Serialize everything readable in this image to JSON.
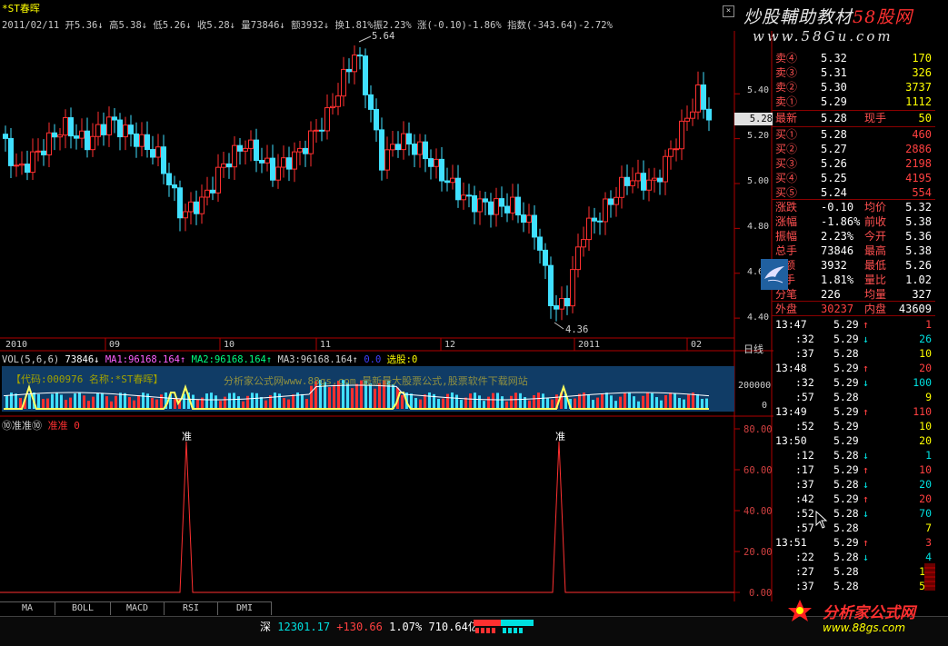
{
  "title_bar": {
    "stock_name": "*ST春晖",
    "close_icon": "close-icon"
  },
  "quote_line": {
    "date": "2011/02/11",
    "open": "开5.36↓",
    "high": "高5.38↓",
    "low": "低5.26↓",
    "close": "收5.28↓",
    "volume": "量73846↓",
    "amount": "额3932↓",
    "turnover": "换1.81%",
    "amplitude": "振2.23%",
    "change": "涨(-0.10)-1.86%",
    "index": "指数(-343.64)-2.72%"
  },
  "watermark": {
    "title_a": "炒股輔助教材",
    "title_b": "58股网",
    "url": "www.58Gu.com"
  },
  "main_chart": {
    "high_label": "5.64",
    "low_label": "4.36",
    "price_axis": [
      "5.40",
      "5.20",
      "5.00",
      "4.80",
      "4.60",
      "4.40"
    ],
    "current_price": "5.28",
    "date_axis": [
      "2010",
      "09",
      "10",
      "11",
      "12",
      "2011",
      "02"
    ],
    "period_label": "日线"
  },
  "volume_panel": {
    "header": {
      "vol": "VOL(5,6,6)",
      "vol_val": "73846↓",
      "ma1": "MA1:96168.164↑",
      "ma2": "MA2:96168.164↑",
      "ma3": "MA3:96168.164↑",
      "tail": "0.0",
      "pick": "选股:0"
    },
    "code_text": "【代码:000976 名称:*ST春晖】",
    "tooltip_text": "分析家公式网www.88gs.com 最新最大股票公式,股票软件下载网站",
    "axis": [
      "200000",
      "0"
    ]
  },
  "indicator_panel": {
    "name": "⑩准准⑩",
    "value": "准准 0",
    "axis": [
      "80.00",
      "60.00",
      "40.00",
      "20.00",
      "0.00"
    ],
    "marker": "准"
  },
  "chart_data": {
    "type": "line",
    "title": "*ST春晖",
    "indicator_spikes_x": [
      "2010-10",
      "2011-01"
    ],
    "indicator_peak": 80,
    "ylim": [
      4.36,
      5.64
    ]
  },
  "order_book": {
    "sell": [
      {
        "label": "卖④",
        "price": "5.32",
        "vol": "170"
      },
      {
        "label": "卖③",
        "price": "5.31",
        "vol": "326"
      },
      {
        "label": "卖②",
        "price": "5.30",
        "vol": "3737"
      },
      {
        "label": "卖①",
        "price": "5.29",
        "vol": "1112"
      }
    ],
    "latest": {
      "label": "最新",
      "price": "5.28",
      "hand_label": "现手",
      "hand": "50"
    },
    "buy": [
      {
        "label": "买①",
        "price": "5.28",
        "vol": "460"
      },
      {
        "label": "买②",
        "price": "5.27",
        "vol": "2886"
      },
      {
        "label": "买③",
        "price": "5.26",
        "vol": "2198"
      },
      {
        "label": "买④",
        "price": "5.25",
        "vol": "4195"
      },
      {
        "label": "买⑤",
        "price": "5.24",
        "vol": "554"
      }
    ],
    "stats": [
      {
        "l1": "涨跌",
        "v1": "-0.10",
        "l2": "均价",
        "v2": "5.32"
      },
      {
        "l1": "涨幅",
        "v1": "-1.86%",
        "l2": "前收",
        "v2": "5.38"
      },
      {
        "l1": "振幅",
        "v1": "2.23%",
        "l2": "今开",
        "v2": "5.36"
      },
      {
        "l1": "总手",
        "v1": "73846",
        "l2": "最高",
        "v2": "5.38"
      },
      {
        "l1": "额",
        "v1": "3932",
        "l2": "最低",
        "v2": "5.26"
      },
      {
        "l1": "手",
        "v1": "1.81%",
        "l2": "量比",
        "v2": "1.02"
      },
      {
        "l1": "分笔",
        "v1": "226",
        "l2": "均量",
        "v2": "327"
      }
    ],
    "outer": {
      "l1": "外盘",
      "v1": "30237",
      "l2": "内盘",
      "v2": "43609"
    }
  },
  "trades": [
    {
      "t": "13:47",
      "p": "5.29",
      "d": "↑",
      "v": "1"
    },
    {
      "t": ":32",
      "p": "5.29",
      "d": "↓",
      "v": "26"
    },
    {
      "t": ":37",
      "p": "5.28",
      "d": "",
      "v": "10"
    },
    {
      "t": "13:48",
      "p": "5.29",
      "d": "↑",
      "v": "20"
    },
    {
      "t": ":32",
      "p": "5.29",
      "d": "↓",
      "v": "100"
    },
    {
      "t": ":57",
      "p": "5.28",
      "d": "",
      "v": "9"
    },
    {
      "t": "13:49",
      "p": "5.29",
      "d": "↑",
      "v": "110"
    },
    {
      "t": ":52",
      "p": "5.29",
      "d": "",
      "v": "10"
    },
    {
      "t": "13:50",
      "p": "5.29",
      "d": "",
      "v": "20"
    },
    {
      "t": ":12",
      "p": "5.28",
      "d": "↓",
      "v": "1"
    },
    {
      "t": ":17",
      "p": "5.29",
      "d": "↑",
      "v": "10"
    },
    {
      "t": ":37",
      "p": "5.28",
      "d": "↓",
      "v": "20"
    },
    {
      "t": ":42",
      "p": "5.29",
      "d": "↑",
      "v": "20"
    },
    {
      "t": ":52",
      "p": "5.28",
      "d": "↓",
      "v": "70"
    },
    {
      "t": ":57",
      "p": "5.28",
      "d": "",
      "v": "7"
    },
    {
      "t": "13:51",
      "p": "5.29",
      "d": "↑",
      "v": "3"
    },
    {
      "t": ":22",
      "p": "5.28",
      "d": "↓",
      "v": "4"
    },
    {
      "t": ":27",
      "p": "5.28",
      "d": "",
      "v": "11"
    },
    {
      "t": ":37",
      "p": "5.28",
      "d": "",
      "v": "50"
    }
  ],
  "tabs": [
    "MA",
    "BOLL",
    "MACD",
    "RSI",
    "DMI"
  ],
  "status_bar": {
    "market": "深",
    "index": "12301.17",
    "change": "+130.66",
    "pct": "1.07%",
    "amount": "710.64亿"
  },
  "logo": {
    "name": "分析家公式网",
    "url": "www.88gs.com"
  }
}
